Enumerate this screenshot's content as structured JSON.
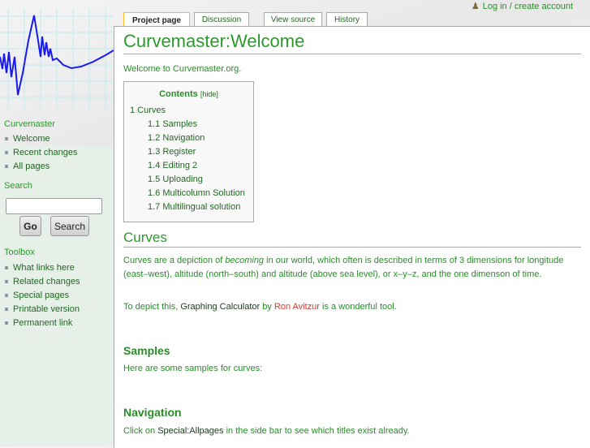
{
  "user": {
    "login": "Log in / create account"
  },
  "tabs": [
    "Project page",
    "Discussion",
    "View source",
    "History"
  ],
  "sidebar": {
    "nav_title": "Curvemaster",
    "nav": [
      "Welcome",
      "Recent changes",
      "All pages"
    ],
    "search_title": "Search",
    "go": "Go",
    "search": "Search",
    "toolbox_title": "Toolbox",
    "toolbox": [
      "What links here",
      "Related changes",
      "Special pages",
      "Printable version",
      "Permanent link"
    ]
  },
  "page": {
    "title": "Curvemaster:Welcome",
    "intro": "Welcome to Curvemaster.org.",
    "toc": {
      "title": "Contents",
      "hide": "[hide]",
      "items": [
        "1 Curves",
        "1.1 Samples",
        "1.2 Navigation",
        "1.3 Register",
        "1.4 Editing 2",
        "1.5 Uploading",
        "1.6 Multicolumn Solution",
        "1.7 Multilingual solution"
      ]
    },
    "curves": {
      "heading": "Curves",
      "p1a": "Curves are a depiction of ",
      "p1em": "becoming",
      "p1b": " in our world, which often is described in terms of 3 dimensions for longitude (east–west), altitude (north–south) and altitude (above sea level), or x–y–z, and the one dimenson of time.",
      "p2a": "To depict this, ",
      "p2link": "Graphing Calculator",
      "p2b": " by ",
      "p2red": "Ron Avitzur",
      "p2c": " is a wonderful tool."
    },
    "samples": {
      "heading": "Samples",
      "text": "Here are some samples for curves:"
    },
    "navigation": {
      "heading": "Navigation",
      "a": "Click on ",
      "link": "Special:Allpages",
      "b": " in the side bar to see which titles exist already."
    }
  }
}
